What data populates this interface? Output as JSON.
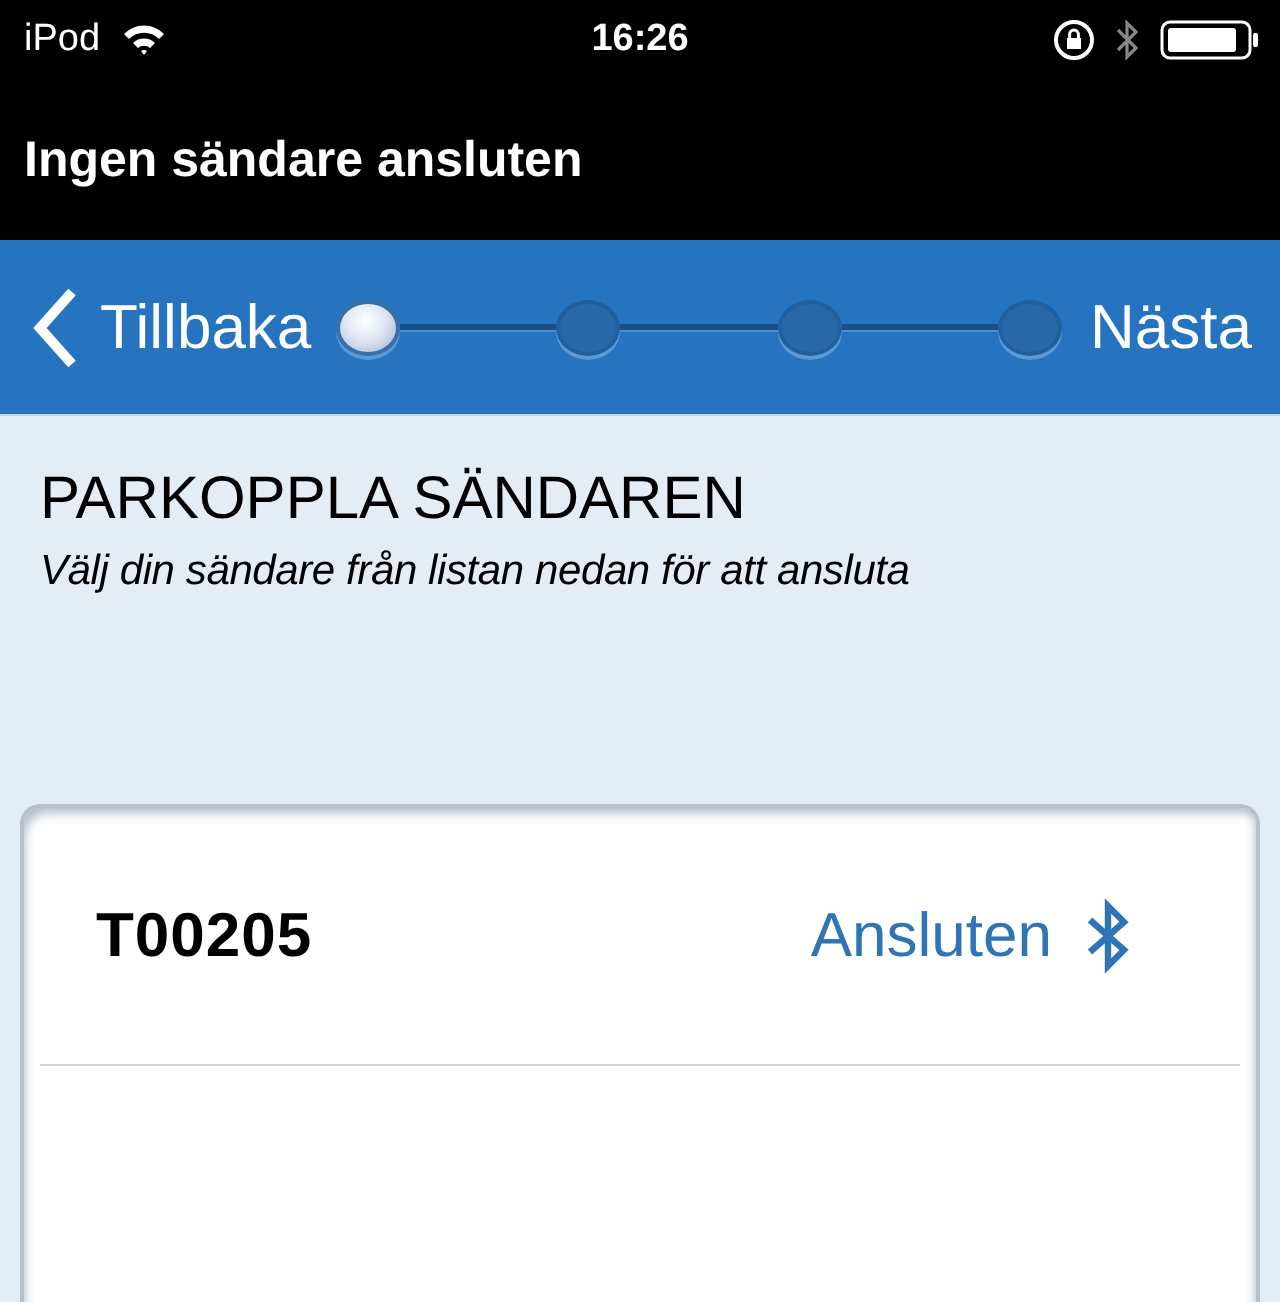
{
  "status_bar": {
    "carrier": "iPod",
    "time": "16:26"
  },
  "title": "Ingen sändare ansluten",
  "nav": {
    "back": "Tillbaka",
    "next": "Nästa",
    "steps": [
      {
        "selected": true
      },
      {
        "selected": false
      },
      {
        "selected": false
      },
      {
        "selected": false
      }
    ]
  },
  "heading": "PARKOPPLA SÄNDAREN",
  "subtitle": "Välj din sändare från listan nedan för att ansluta",
  "devices": [
    {
      "name": "T00205",
      "status": "Ansluten",
      "connected": true
    }
  ]
}
